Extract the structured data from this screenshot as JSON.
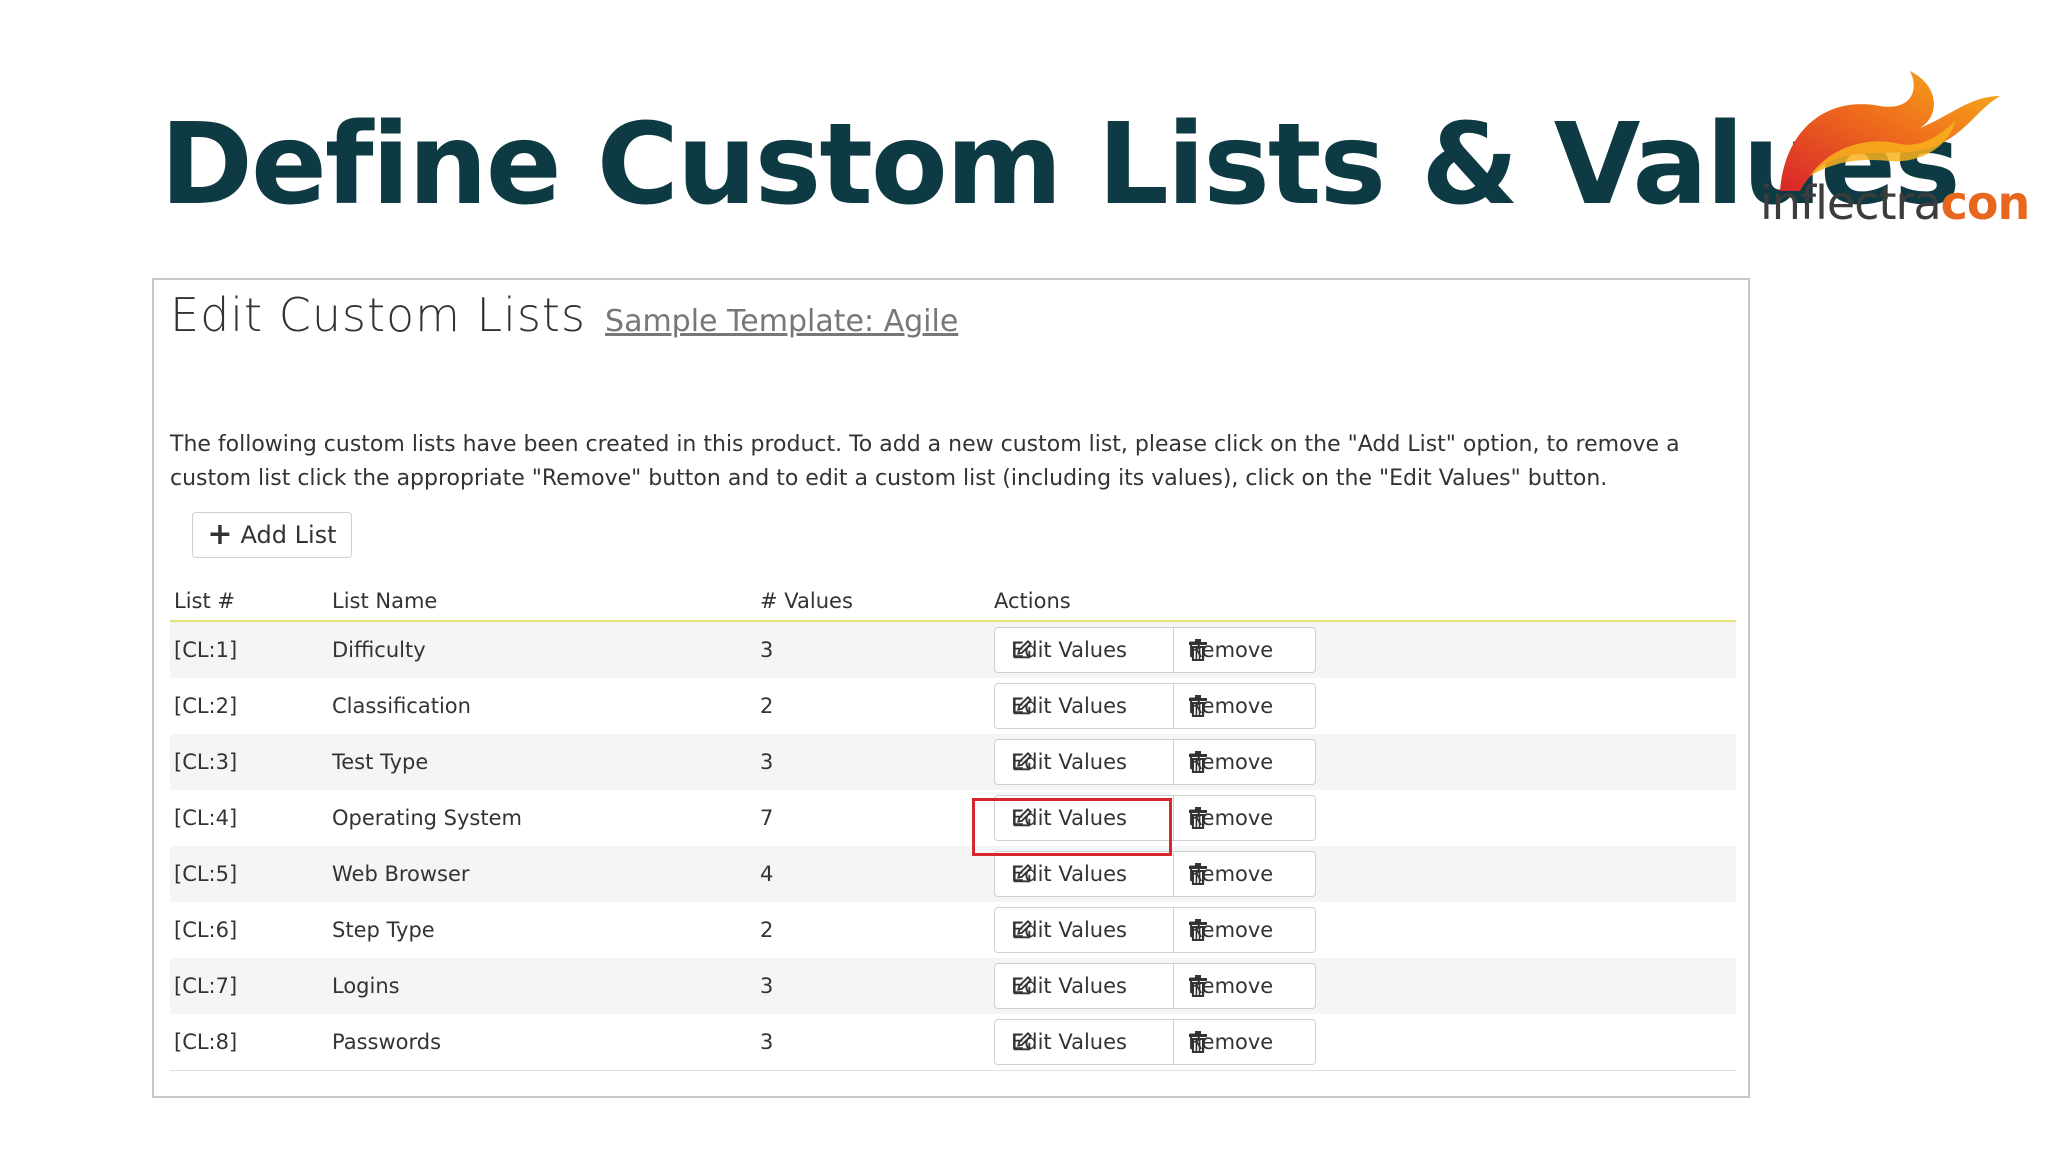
{
  "slide": {
    "title": "Define Custom Lists & Values"
  },
  "logo": {
    "text_light": "inflectra",
    "text_bold": "con"
  },
  "panel": {
    "title": "Edit Custom Lists",
    "template_link": "Sample Template: Agile",
    "intro": "The following custom lists have been created in this product. To add a new custom list, please click on the \"Add List\" option, to remove a custom list click the appropriate \"Remove\" button and to edit a custom list (including its values), click on the \"Edit Values\" button.",
    "add_button": "Add List"
  },
  "table": {
    "headers": {
      "list_num": "List #",
      "list_name": "List Name",
      "values": "# Values",
      "actions": "Actions"
    },
    "edit_label": "Edit Values",
    "remove_label": "Remove",
    "rows": [
      {
        "id": "[CL:1]",
        "name": "Difficulty",
        "count": "3"
      },
      {
        "id": "[CL:2]",
        "name": "Classification",
        "count": "2"
      },
      {
        "id": "[CL:3]",
        "name": "Test Type",
        "count": "3"
      },
      {
        "id": "[CL:4]",
        "name": "Operating System",
        "count": "7"
      },
      {
        "id": "[CL:5]",
        "name": "Web Browser",
        "count": "4"
      },
      {
        "id": "[CL:6]",
        "name": "Step Type",
        "count": "2"
      },
      {
        "id": "[CL:7]",
        "name": "Logins",
        "count": "3"
      },
      {
        "id": "[CL:8]",
        "name": "Passwords",
        "count": "3"
      }
    ]
  },
  "colors": {
    "title": "#0e3b43",
    "highlight": "#d9262c",
    "header_rule": "#e8e27a",
    "logo_orange": "#e8671e"
  },
  "icons": {
    "add": "plus-icon",
    "edit": "edit-icon",
    "remove": "trash-icon"
  }
}
